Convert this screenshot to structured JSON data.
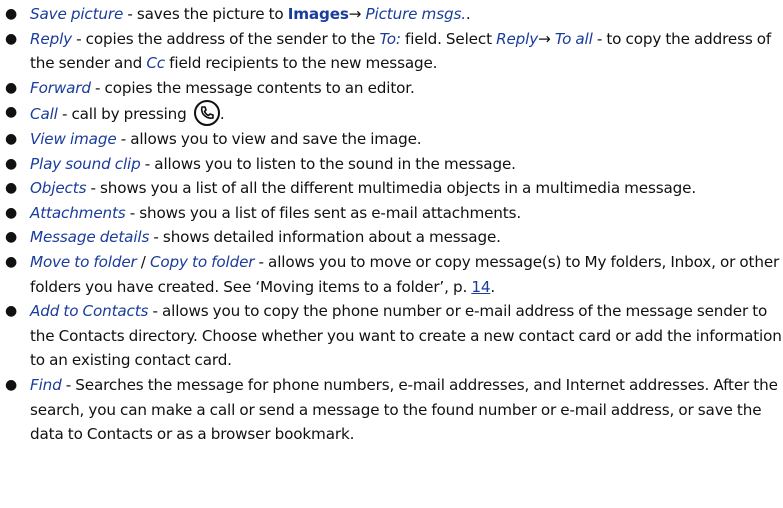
{
  "items": [
    {
      "term": "Save picture",
      "text": " - saves the picture to ",
      "link1": "Images",
      "arrow": "→",
      "link2": " Picture msgs.",
      "end": "."
    },
    {
      "term": "Reply",
      "text1": " - copies the address of the sender to the ",
      "field": "To:",
      "text2": " field. Select ",
      "term2": "Reply",
      "arrow": "→",
      "term3": " To all",
      "text3": " - to copy the address of the sender and ",
      "field2": "Cc",
      "text4": " field recipients to the new message."
    },
    {
      "term": "Forward",
      "text": " - copies the message contents to an editor."
    },
    {
      "term": "Call",
      "text": " - call by pressing ",
      "end": "."
    },
    {
      "term": "View image",
      "text": " - allows you to view and save the image."
    },
    {
      "term": "Play sound clip",
      "text": " - allows you to listen to the sound in the message."
    },
    {
      "term": "Objects",
      "text": " - shows you a list of all the different multimedia objects in a multimedia message."
    },
    {
      "term": "Attachments",
      "text": " - shows you a list of files sent as e-mail attachments."
    },
    {
      "term": "Message details",
      "text": " - shows detailed information about a message."
    },
    {
      "term": "Move to folder",
      "sep": " / ",
      "term2": "Copy to folder",
      "text": " - allows you to move or copy message(s) to My folders, Inbox, or other folders you have created. See ‘Moving items to a folder’, p. ",
      "page": "14",
      "end": "."
    },
    {
      "term": "Add to Contacts",
      "text": " - allows you to copy the phone number or e-mail address of the message sender to the Contacts directory. Choose whether you want to create a new contact card or add the information to an existing contact card."
    },
    {
      "term": "Find",
      "text": " - Searches the message for phone numbers, e-mail addresses, and Internet addresses. After the search, you can make a call or send a message to the found number or e-mail address, or save the data to Contacts or as a browser bookmark."
    }
  ],
  "bullet": "●",
  "icons": {
    "call_key": "phone-call-key-icon"
  },
  "colors": {
    "term": "#1a3c9c",
    "text": "#111111"
  }
}
